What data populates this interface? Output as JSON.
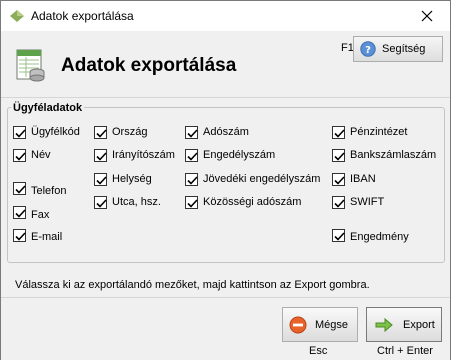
{
  "window": {
    "title": "Adatok exportálása",
    "close_icon": "close-icon"
  },
  "header": {
    "title": "Adatok exportálása",
    "help_shortcut": "F1",
    "help_label": "Segítség"
  },
  "group": {
    "title": "Ügyféladatok",
    "fields": [
      {
        "label": "Ügyfélkód",
        "checked": true
      },
      {
        "label": "Név",
        "checked": true
      },
      {
        "label": "Telefon",
        "checked": true
      },
      {
        "label": "Fax",
        "checked": true
      },
      {
        "label": "E-mail",
        "checked": true
      },
      {
        "label": "Ország",
        "checked": true
      },
      {
        "label": "Irányítószám",
        "checked": true
      },
      {
        "label": "Helység",
        "checked": true
      },
      {
        "label": "Utca, hsz.",
        "checked": true
      },
      {
        "label": "Adószám",
        "checked": true
      },
      {
        "label": "Engedélyszám",
        "checked": true
      },
      {
        "label": "Jövedéki engedélyszám",
        "checked": true
      },
      {
        "label": "Közösségi adószám",
        "checked": true
      },
      {
        "label": "Pénzintézet",
        "checked": true
      },
      {
        "label": "Bankszámlaszám",
        "checked": true
      },
      {
        "label": "IBAN",
        "checked": true
      },
      {
        "label": "SWIFT",
        "checked": true
      },
      {
        "label": "Engedmény",
        "checked": true
      }
    ]
  },
  "hint": "Válassza ki az exportálandó mezőket, majd kattintson az Export gombra.",
  "footer": {
    "cancel_label": "Mégse",
    "cancel_shortcut": "Esc",
    "export_label": "Export",
    "export_shortcut": "Ctrl + Enter"
  }
}
